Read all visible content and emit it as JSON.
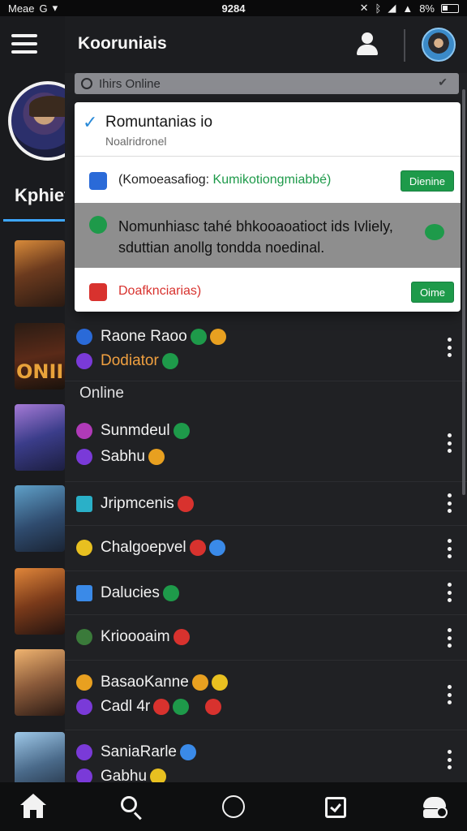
{
  "status_bar": {
    "carrier": "Meae",
    "time": "9284",
    "battery": "8%"
  },
  "rail": {
    "label": "Kphiet"
  },
  "header": {
    "title": "Kooruniais"
  },
  "online_filter": {
    "label": "Ihirs Online"
  },
  "popup": {
    "title": "Romuntanias io",
    "subtitle": "Noalridronel",
    "row1": {
      "label": "(Komoeasafiog: ",
      "accent": "Kumikotiongmiabbé)",
      "button": "Dienine"
    },
    "row2": {
      "text": "Nomunhiasc tahé bhkooaoatioct ids Ivliely, sduttian anollg tondda noedinal."
    },
    "row3": {
      "label": "Doafknciarias)",
      "button": "Oime"
    }
  },
  "friends_top": [
    {
      "line1": "Raone Raoo",
      "line2": "Dodiator"
    }
  ],
  "section_label": "Online",
  "friends": [
    {
      "line1": "Sunmdeul",
      "line2": "Sabhu"
    },
    {
      "line1": "Jripmcenis"
    },
    {
      "line1": "Chalgoepvel"
    },
    {
      "line1": "Dalucies"
    },
    {
      "line1": "Krioooaim"
    },
    {
      "line1": "BasaoKanne",
      "line2": "Cadl 4r"
    },
    {
      "line1": "SaniaRarle",
      "line2": "Gabhu"
    }
  ],
  "colors": {
    "accent_blue": "#3ea6ff",
    "online_green": "#1e9a4a",
    "alert_red": "#d8322e",
    "name_orange": "#f0a040"
  },
  "icons": [
    "hamburger-icon",
    "user-icon",
    "search-icon",
    "home-icon",
    "circle-icon",
    "clipboard-check-icon",
    "profile-settings-icon",
    "kebab-menu-icon"
  ]
}
